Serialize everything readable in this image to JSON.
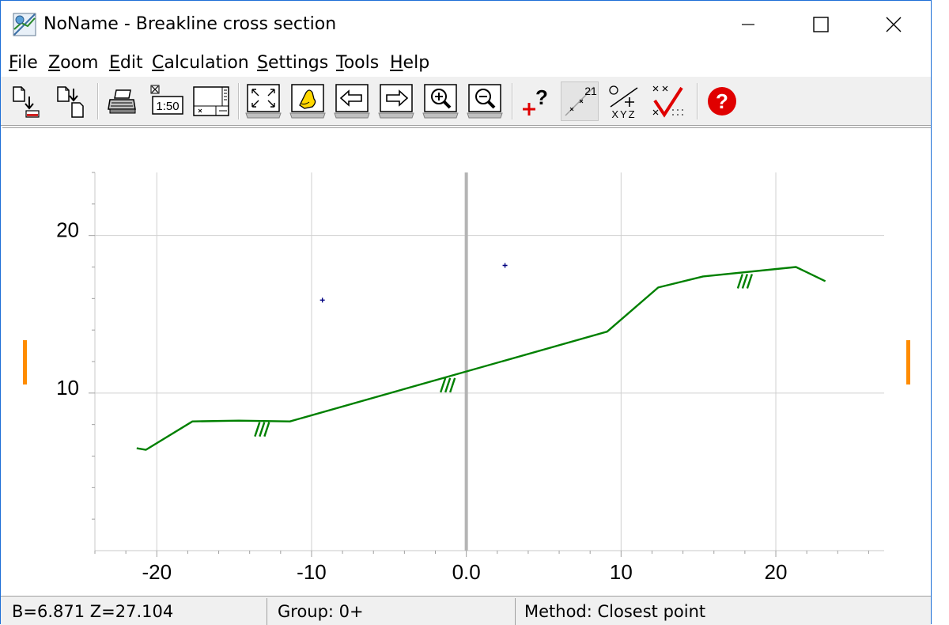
{
  "window": {
    "app_name": "NoName",
    "separator": "-",
    "title": "Breakline cross section",
    "controls": [
      "minimize-icon",
      "maximize-icon",
      "close-icon"
    ]
  },
  "menu": {
    "items": [
      {
        "mnemonic": "F",
        "rest": "ile"
      },
      {
        "mnemonic": "Z",
        "rest": "oom"
      },
      {
        "mnemonic": "E",
        "rest": "dit"
      },
      {
        "mnemonic": "C",
        "rest": "alculation"
      },
      {
        "mnemonic": "S",
        "rest": "ettings"
      },
      {
        "mnemonic": "T",
        "rest": "ools"
      },
      {
        "mnemonic": "H",
        "rest": "elp"
      }
    ]
  },
  "toolbar": {
    "scale_label": "1:50",
    "points_label": "21",
    "xyz_label": "XYZ",
    "query_label": "?",
    "help_label": "?",
    "buttons": [
      "open-file-icon",
      "save-file-icon",
      "print-icon",
      "scale-icon",
      "page-setup-icon",
      "zoom-extents-icon",
      "pan-icon",
      "previous-section-icon",
      "next-section-icon",
      "zoom-in-icon",
      "zoom-out-icon",
      "query-point-icon",
      "show-points-icon",
      "coordinates-icon",
      "check-icon",
      "help-icon"
    ]
  },
  "chart_data": {
    "type": "line",
    "title": "",
    "xlabel": "",
    "ylabel": "",
    "xlim": [
      -24,
      27
    ],
    "ylim": [
      0,
      24
    ],
    "x_ticks": [
      -20,
      -10,
      0,
      10,
      20
    ],
    "x_tick_labels": [
      "-20",
      "-10",
      "0.0",
      "10",
      "20"
    ],
    "y_ticks": [
      10,
      20
    ],
    "y_tick_labels": [
      "10",
      "20"
    ],
    "grid": true,
    "center_line_x": 0,
    "series": [
      {
        "color": "#008000",
        "x": [
          -21.3,
          -20.7,
          -17.7,
          -14.7,
          -11.4,
          9.1,
          12.4,
          15.3,
          21.3,
          23.2
        ],
        "y": [
          6.5,
          6.4,
          8.2,
          8.25,
          8.2,
          13.9,
          16.7,
          17.4,
          18.0,
          17.1
        ]
      }
    ],
    "breakline_markers": [
      {
        "x": -13.2,
        "y": 8.2
      },
      {
        "x": -1.2,
        "y": 11.0
      },
      {
        "x": 18.0,
        "y": 17.6
      }
    ],
    "survey_points": [
      {
        "x": -9.3,
        "y": 15.9
      },
      {
        "x": 2.5,
        "y": 18.1
      }
    ],
    "side_markers_color": "#ff8c00"
  },
  "status": {
    "coords": "B=6.871  Z=27.104",
    "group": "Group: 0+",
    "method": "Method: Closest point"
  }
}
